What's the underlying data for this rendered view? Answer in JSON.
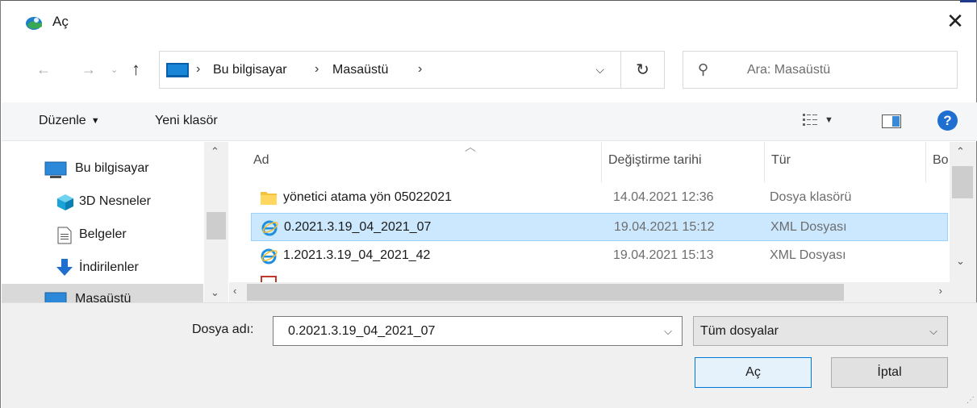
{
  "window": {
    "title": "Aç",
    "close_glyph": "✕"
  },
  "address_bar": {
    "crumbs": [
      "Bu bilgisayar",
      "Masaüstü"
    ],
    "search_placeholder": "Ara: Masaüstü"
  },
  "toolbar": {
    "organize_label": "Düzenle",
    "new_folder_label": "Yeni klasör",
    "help_label": "?"
  },
  "nav_pane": {
    "items": [
      {
        "label": "Bu bilgisayar",
        "icon": "computer-icon"
      },
      {
        "label": "3D Nesneler",
        "icon": "cube-3d-icon"
      },
      {
        "label": "Belgeler",
        "icon": "document-icon"
      },
      {
        "label": "İndirilenler",
        "icon": "download-arrow-icon"
      },
      {
        "label": "Masaüstü",
        "icon": "desktop-icon",
        "selected": true
      }
    ]
  },
  "file_list": {
    "columns": [
      "Ad",
      "Değiştirme tarihi",
      "Tür",
      "Bo"
    ],
    "rows": [
      {
        "name": "yönetici atama yön 05022021",
        "modified": "14.04.2021 12:36",
        "type": "Dosya klasörü",
        "icon": "folder-icon"
      },
      {
        "name": "0.2021.3.19_04_2021_07",
        "modified": "19.04.2021 15:12",
        "type": "XML Dosyası",
        "icon": "internet-explorer-icon",
        "selected": true
      },
      {
        "name": "1.2021.3.19_04_2021_42",
        "modified": "19.04.2021 15:13",
        "type": "XML Dosyası",
        "icon": "internet-explorer-icon"
      }
    ]
  },
  "bottom": {
    "filename_label": "Dosya adı:",
    "filename_value": "0.2021.3.19_04_2021_07",
    "filetype_value": "Tüm dosyalar",
    "open_label": "Aç",
    "cancel_label": "İptal"
  },
  "colors": {
    "selection_bg": "#cce8ff",
    "selection_border": "#99d1ff",
    "accent": "#0078d7"
  }
}
